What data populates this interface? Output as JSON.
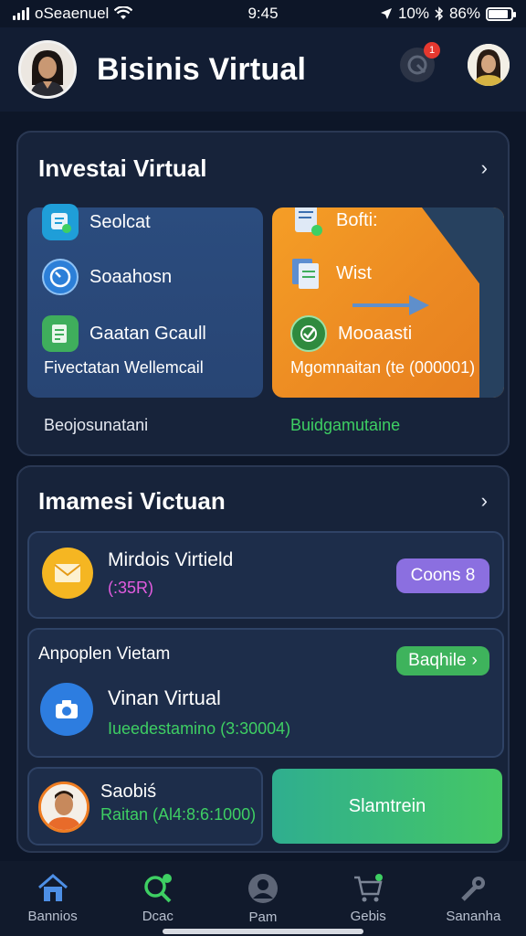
{
  "status": {
    "carrier": "oSeaenuel",
    "time": "9:45",
    "battery_text": "10%",
    "battery_pct": "86%",
    "battery_level": 0.86
  },
  "header": {
    "title": "Bisinis Virtual",
    "notification_count": "1"
  },
  "invest_card": {
    "title": "Investai Virtual",
    "blue_tile": {
      "items": [
        "Seolcat",
        "Soaahosn",
        "Gaatan Gcaull"
      ],
      "footer": "Fivectatan Wellemcail"
    },
    "orange_tile": {
      "items": [
        "Bofti:",
        "Wist",
        "Mooaasti"
      ],
      "footer": "Mgomnaitan (te (000001)"
    },
    "caption_left": "Beojosunatani",
    "caption_right": "Buidgamutaine"
  },
  "second_card": {
    "title": "Imamesi Victuan",
    "row1": {
      "name": "Mirdois Virtield",
      "value": "(:35R)",
      "button": "Coons 8"
    },
    "row2": {
      "header": "Anpoplen Vietam",
      "button": "Baqhile",
      "name": "Vinan Virtual",
      "value": "Iueedestamino (3:30004)"
    },
    "row3": {
      "name": "Saobiś",
      "value": "Raitan (Al4:8:6:1000)",
      "button": "Slamtrein"
    }
  },
  "bottom_nav": {
    "items": [
      "Bannios",
      "Dcac",
      "Pam",
      "Gebis",
      "Sananha"
    ]
  },
  "colors": {
    "background": "#0d1628",
    "card": "#17233a",
    "accent_green": "#3ecf63",
    "accent_purple": "#8b6fe0",
    "accent_orange": "#f1932a",
    "magenta": "#e35ce0"
  }
}
